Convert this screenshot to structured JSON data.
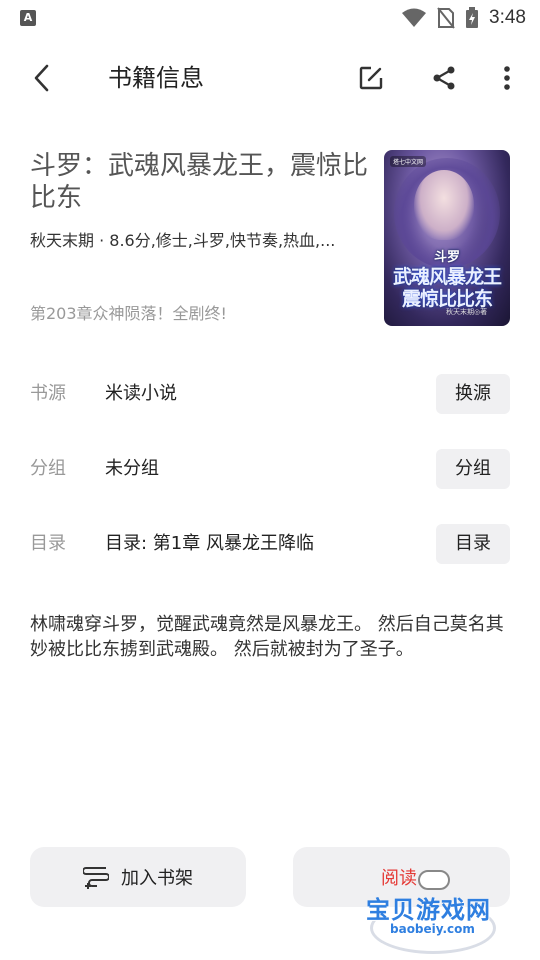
{
  "status_bar": {
    "left_icon": "A",
    "time": "3:48",
    "icons": [
      "wifi-icon",
      "no-sim-icon",
      "battery-charging-icon"
    ]
  },
  "app_bar": {
    "title": "书籍信息",
    "icons": [
      "back-arrow-icon",
      "edit-icon",
      "share-icon",
      "more-vert-icon"
    ]
  },
  "book": {
    "title": "斗罗：武魂风暴龙王，震惊比比东",
    "meta": "秋天末期 · 8.6分,修士,斗罗,快节奏,热血,...",
    "latest_chapter": "第203章众神陨落！全剧终!",
    "cover": {
      "publisher": "塔七中文网",
      "line1": "斗罗",
      "line2": "武魂风暴龙王",
      "line3": "震惊比比东",
      "author": "秋天末期◎著"
    }
  },
  "rows": [
    {
      "label": "书源",
      "value": "米读小说",
      "button": "换源"
    },
    {
      "label": "分组",
      "value": "未分组",
      "button": "分组"
    },
    {
      "label": "目录",
      "value": "目录: 第1章 风暴龙王降临",
      "button": "目录"
    }
  ],
  "intro": "林啸魂穿斗罗，觉醒武魂竟然是风暴龙王。 然后自己莫名其妙被比比东掳到武魂殿。 然后就被封为了圣子。",
  "bottom": {
    "add_shelf_label": "加入书架",
    "read_label": "阅读"
  },
  "watermark": {
    "text": "宝贝游戏网",
    "url": "baobeiy.com"
  },
  "colors": {
    "read_accent": "#e53935",
    "button_bg": "#f0f0f2",
    "watermark_blue": "#2f7fe0"
  }
}
